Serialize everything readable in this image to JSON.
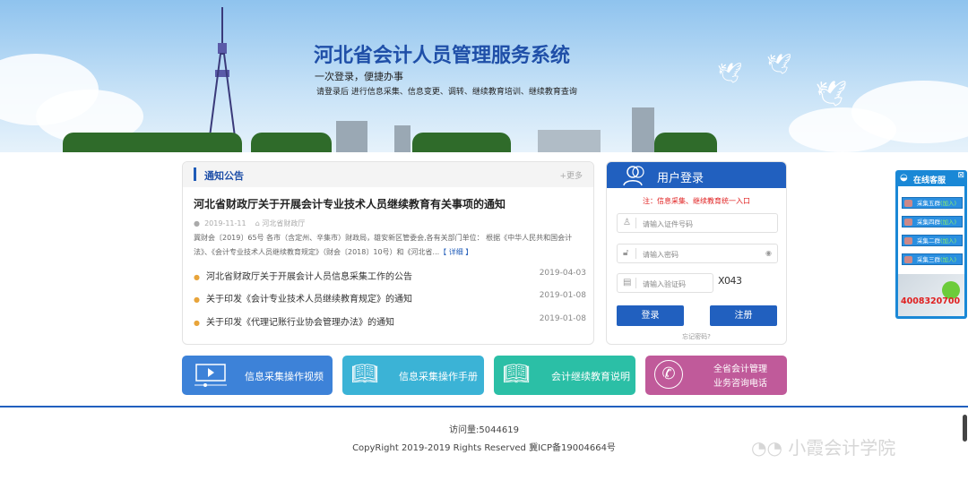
{
  "banner": {
    "title": "河北省会计人员管理服务系统",
    "subtitle": "一次登录，便捷办事",
    "desc": "请登录后 进行信息采集、信息变更、调转、继续教育培训、继续教育查询"
  },
  "notice": {
    "title": "通知公告",
    "more": "+更多",
    "headline": "河北省财政厅关于开展会计专业技术人员继续教育有关事项的通知",
    "date": "2019-11-11",
    "source": "河北省财政厅",
    "summary": "冀财会〔2019〕65号   各市（含定州、辛集市）财政局，雄安新区管委会,各有关部门单位：    根据《中华人民共和国会计法》、《会计专业技术人员继续教育规定》（财会〔2018〕10号）和《河北省...",
    "detail": "【 详细 】",
    "items": [
      {
        "title": "河北省财政厅关于开展会计人员信息采集工作的公告",
        "date": "2019-04-03"
      },
      {
        "title": "关于印发《会计专业技术人员继续教育规定》的通知",
        "date": "2019-01-08"
      },
      {
        "title": "关于印发《代理记账行业协会管理办法》的通知",
        "date": "2019-01-08"
      }
    ]
  },
  "login": {
    "title": "用户登录",
    "note": "注：信息采集、继续教育统一入口",
    "id_placeholder": "请输入证件号码",
    "pwd_placeholder": "请输入密码",
    "captcha_placeholder": "请输入验证码",
    "captcha": "X043",
    "login": "登录",
    "register": "注册",
    "forgot": "忘记密码?"
  },
  "tiles": [
    {
      "label": "信息采集操作视频",
      "color": "#3d82d8"
    },
    {
      "label": "信息采集操作手册",
      "color": "#3bb3d6"
    },
    {
      "label": "会计继续教育说明",
      "color": "#2bbfa6"
    },
    {
      "label1": "全省会计管理",
      "label2": "业务咨询电话",
      "color": "#c05a9a"
    }
  ],
  "footer": {
    "visits": "访问量:5044619",
    "copyright": "CopyRight 2019-2019 Rights Reserved 冀ICP备19004664号"
  },
  "kefu": {
    "title": "在线客服",
    "close": "⊠",
    "join": "(加入)",
    "groups": [
      "采集五群",
      "采集四群",
      "采集二群",
      "采集三群"
    ],
    "phone": "4008320700"
  },
  "watermark": "小霞会计学院"
}
